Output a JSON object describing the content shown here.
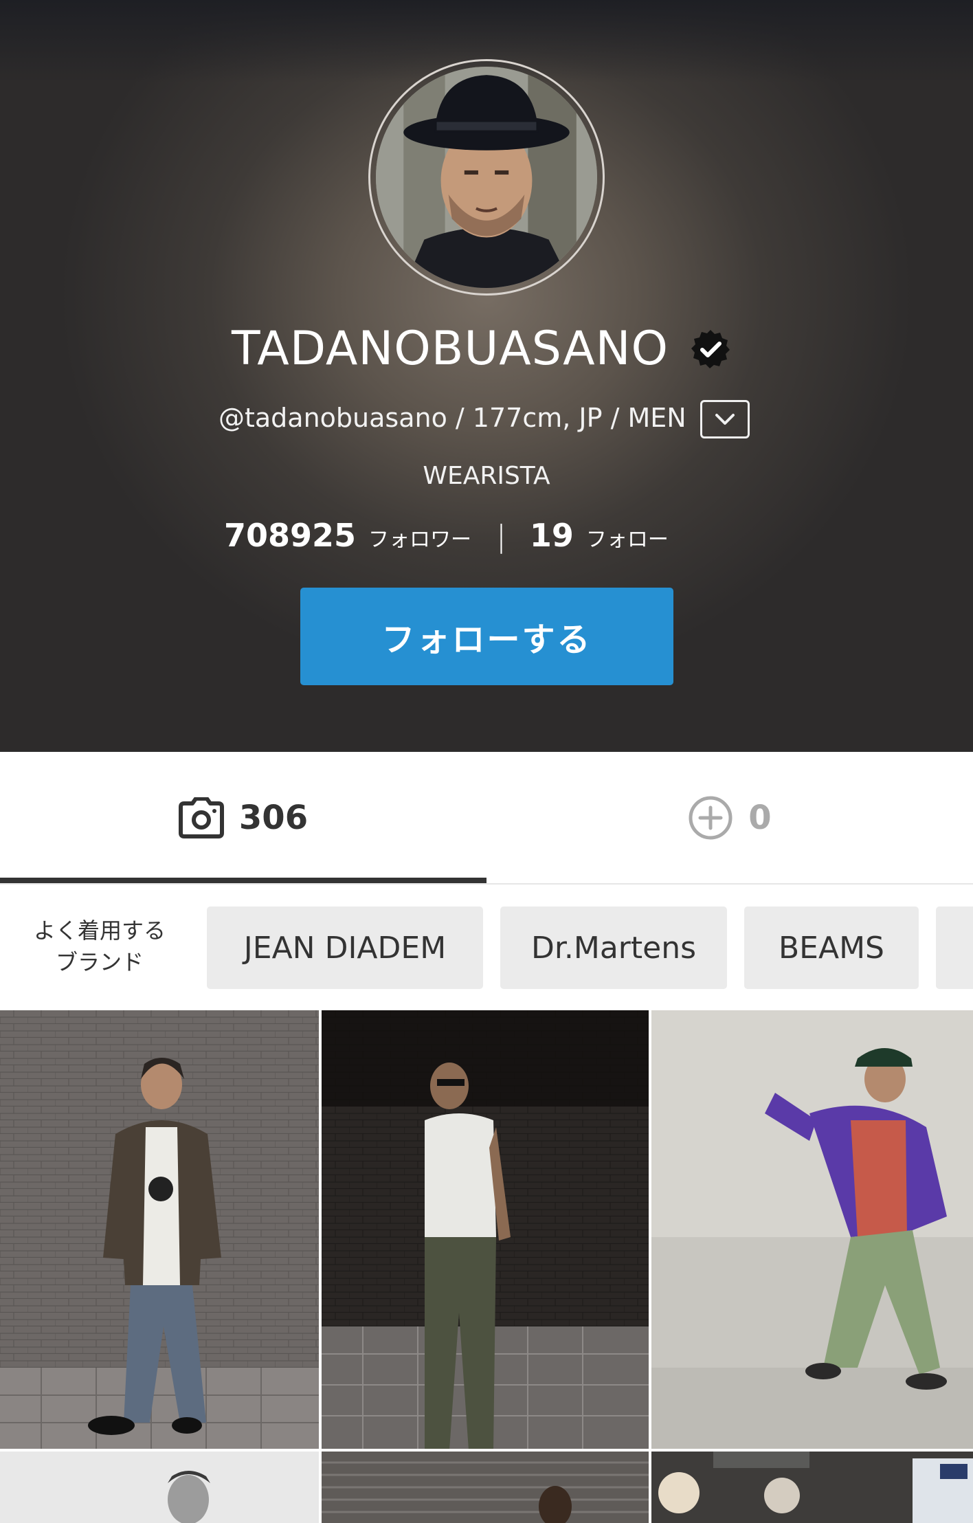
{
  "profile": {
    "display_name": "TADANOBUASANO",
    "meta": "@tadanobuasano / 177cm, JP / MEN",
    "role": "WEARISTA",
    "followers_count": "708925",
    "followers_label": "フォロワー",
    "following_count": "19",
    "following_label": "フォロー",
    "follow_button_label": "フォローする"
  },
  "tabs": {
    "posts_count": "306",
    "other_count": "0"
  },
  "brands": {
    "heading_line1": "よく着用する",
    "heading_line2": "ブランド",
    "items": [
      "JEAN DIADEM",
      "Dr.Martens",
      "BEAMS"
    ]
  },
  "colors": {
    "accent": "#2690d2",
    "tab_active": "#333333",
    "chip_bg": "#ebebeb"
  }
}
